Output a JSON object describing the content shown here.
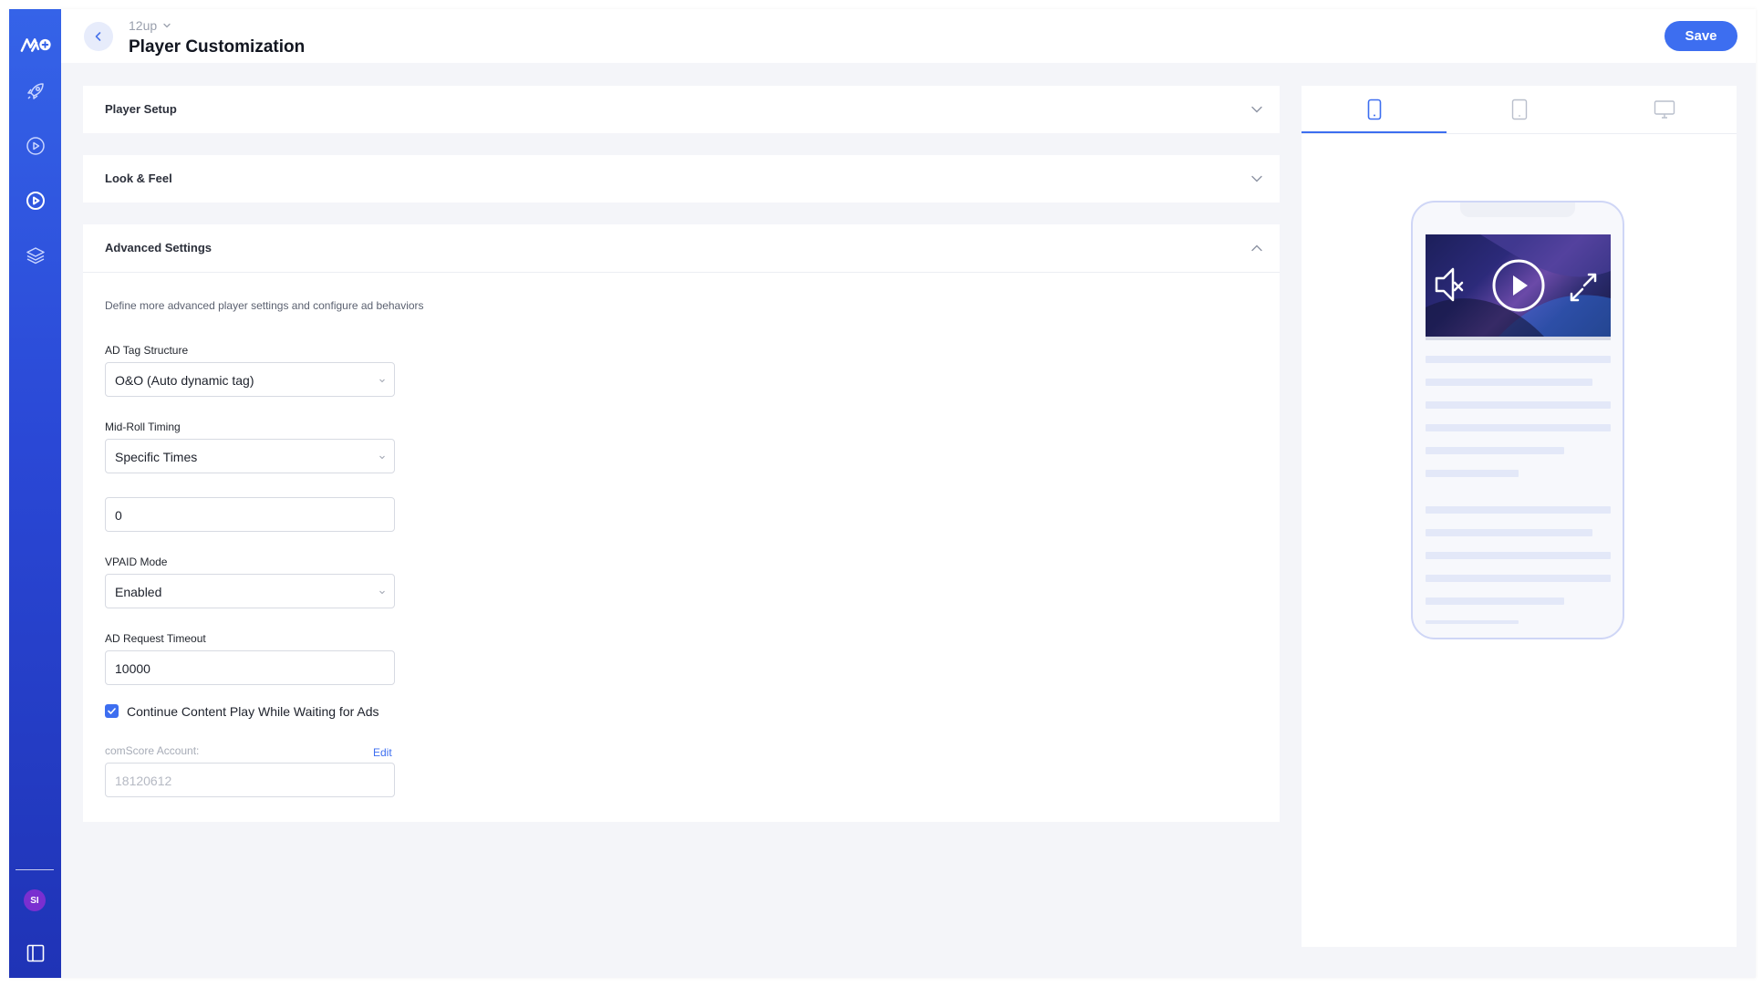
{
  "header": {
    "breadcrumb": "12up",
    "title": "Player Customization",
    "save_label": "Save"
  },
  "sidebar": {
    "icons": [
      "logo-icon",
      "rocket-icon",
      "play-circle-icon",
      "play-circle-active-icon",
      "layers-icon"
    ],
    "avatar_initials": "SI"
  },
  "sections": {
    "player_setup": {
      "title": "Player Setup"
    },
    "look_feel": {
      "title": "Look & Feel"
    },
    "advanced": {
      "title": "Advanced Settings",
      "description": "Define more advanced player settings and configure ad behaviors",
      "ad_tag_label": "AD Tag Structure",
      "ad_tag_value": "O&O (Auto dynamic tag)",
      "midroll_label": "Mid-Roll Timing",
      "midroll_value": "Specific Times",
      "midroll_times_value": "0",
      "vpaid_label": "VPAID Mode",
      "vpaid_value": "Enabled",
      "timeout_label": "AD Request Timeout",
      "timeout_value": "10000",
      "continue_label": "Continue Content Play While Waiting for Ads",
      "continue_checked": true,
      "comscore_label": "comScore Account:",
      "comscore_edit": "Edit",
      "comscore_value": "18120612"
    }
  },
  "preview": {
    "device_tabs": [
      "mobile",
      "tablet",
      "desktop"
    ],
    "active_tab": "mobile"
  },
  "colors": {
    "accent": "#3d6ef0",
    "sidebar_top": "#3563e8",
    "sidebar_bottom": "#1f33b6"
  }
}
